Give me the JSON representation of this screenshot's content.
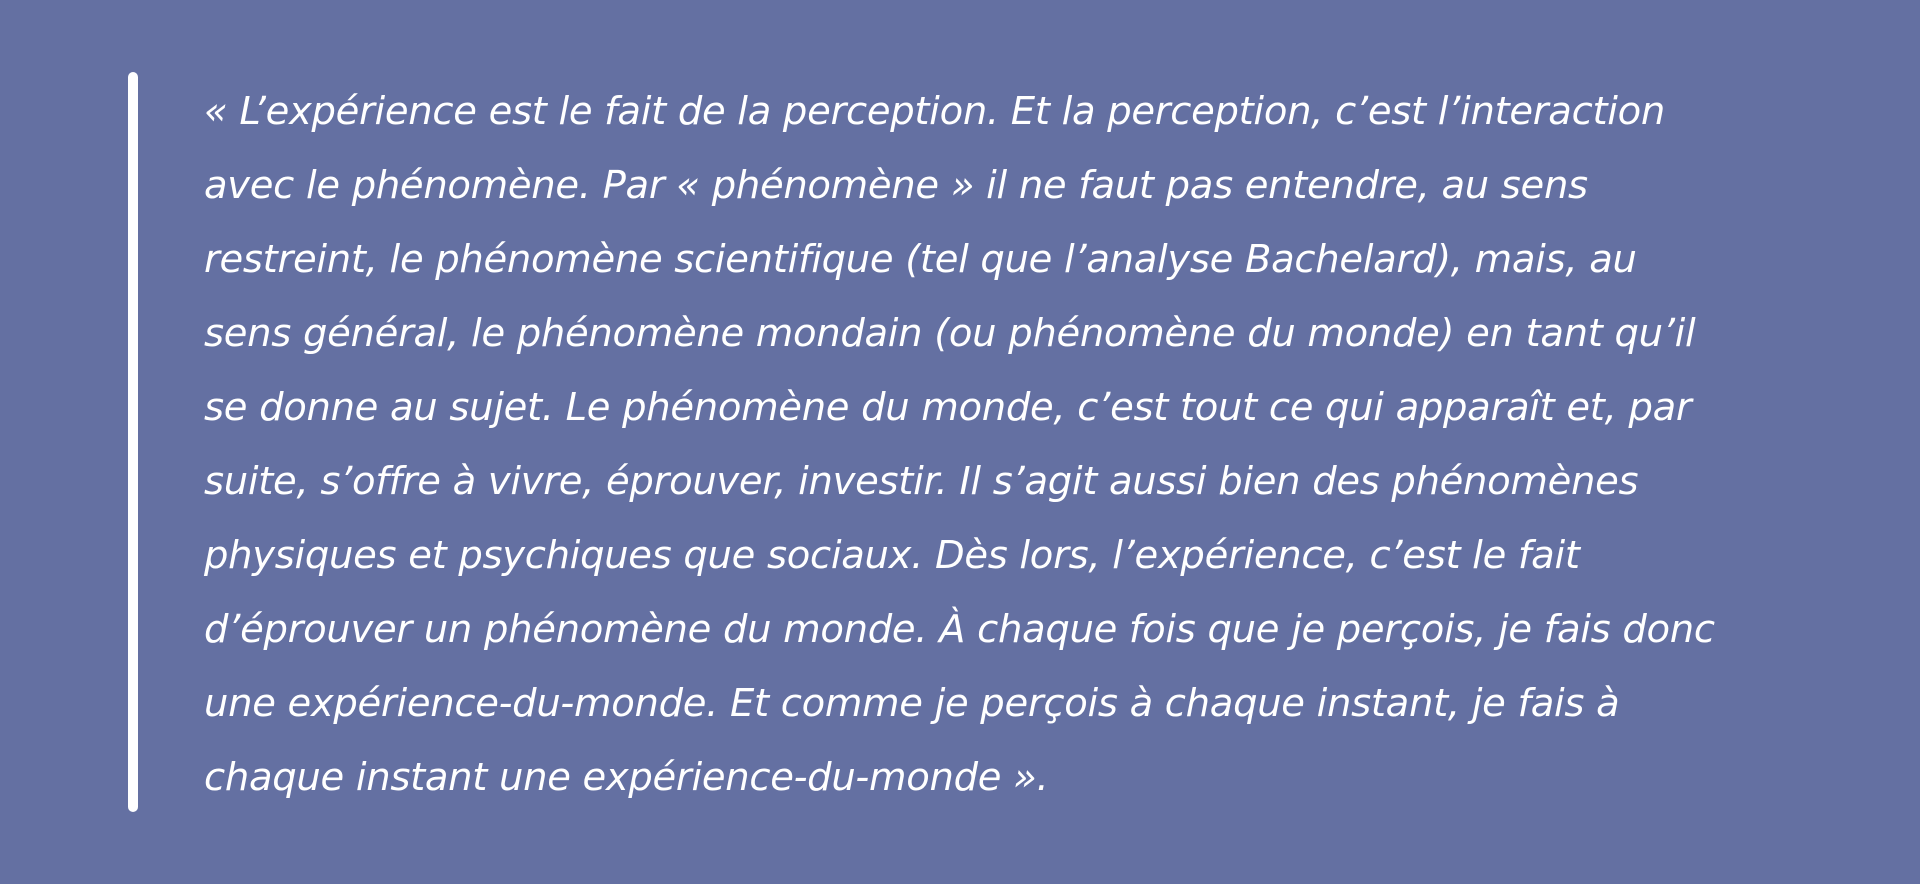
{
  "quote": {
    "lines": [
      " « L’expérience est le fait de la perception. Et la perception, c’est l’interaction",
      "avec le phénomène. Par « phénomène » il ne faut pas entendre, au sens",
      "restreint, le phénomène scientifique (tel que l’analyse Bachelard), mais, au",
      "sens général, le phénomène mondain (ou phénomène du monde) en tant qu’il",
      "se donne au sujet. Le phénomène du monde, c’est tout ce qui apparaît et, par",
      "suite, s’offre à vivre, éprouver, investir. Il s’agit aussi bien des phénomènes",
      "physiques et psychiques que sociaux. Dès lors, l’expérience, c’est le fait",
      "d’éprouver un phénomène du monde. À chaque fois que je perçois, je fais donc",
      "une expérience-du-monde. Et comme je perçois à chaque instant, je fais à",
      "chaque instant une expérience-du-monde »."
    ]
  },
  "colors": {
    "background": "#6470a2",
    "text": "#ffffff",
    "bar": "#ffffff"
  }
}
